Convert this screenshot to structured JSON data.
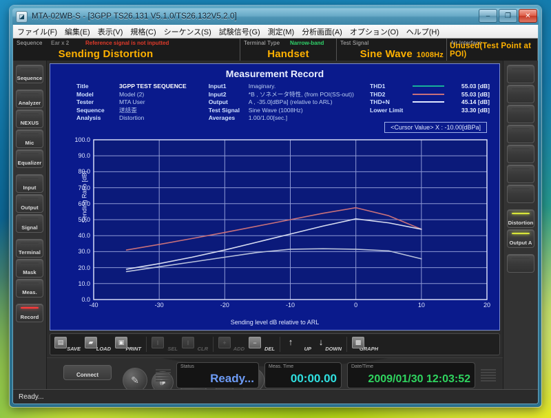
{
  "window": {
    "title": "MTA-02WB-S - [3GPP TS26.131 V5.1.0/TS26.132V5.2.0]",
    "icon": "app-icon",
    "minimize": "–",
    "maximize": "❐",
    "close": "✕"
  },
  "menubar": {
    "items": [
      "ファイル(F)",
      "編集(E)",
      "表示(V)",
      "規格(C)",
      "シーケンス(S)",
      "試験信号(G)",
      "測定(M)",
      "分析画面(A)",
      "オプション(O)",
      "ヘルプ(H)"
    ]
  },
  "infostrip": {
    "sequence_label": "Sequence",
    "ear_label": "Ear x 2",
    "warning": "Reference signal is not inputted",
    "sequence_value": "Sending Distortion",
    "terminal_label": "Terminal Type",
    "terminal_band": "Narrow-band",
    "terminal_value": "Handset",
    "testsignal_label": "Test Signal",
    "testsignal_value": "Sine Wave",
    "testsignal_freq": "1008Hz",
    "airinterface_label": "Air Interface",
    "airinterface_value": "Unused(Test Point at POI)"
  },
  "left_sidebar": {
    "items": [
      {
        "label": "Sequence",
        "state": "normal"
      },
      {
        "label": "Analyzer",
        "state": "normal"
      },
      {
        "label": "NEXUS",
        "state": "normal"
      },
      {
        "label": "Mic",
        "state": "normal"
      },
      {
        "label": "Equalizer",
        "state": "normal"
      },
      {
        "label": "Input",
        "state": "normal"
      },
      {
        "label": "Output",
        "state": "normal"
      },
      {
        "label": "Signal",
        "state": "normal"
      },
      {
        "label": "Terminal",
        "state": "normal"
      },
      {
        "label": "Mask",
        "state": "normal"
      },
      {
        "label": "Meas.",
        "state": "normal"
      },
      {
        "label": "Record",
        "state": "active-red"
      }
    ]
  },
  "right_sidebar": {
    "items": [
      {
        "label": "",
        "state": "empty"
      },
      {
        "label": "",
        "state": "empty"
      },
      {
        "label": "",
        "state": "empty"
      },
      {
        "label": "",
        "state": "empty"
      },
      {
        "label": "",
        "state": "empty"
      },
      {
        "label": "",
        "state": "empty"
      },
      {
        "label": "",
        "state": "empty"
      },
      {
        "label": "Distortion",
        "state": "active-yellow"
      },
      {
        "label": "Output A",
        "state": "active-yellow"
      },
      {
        "label": "",
        "state": "empty"
      }
    ]
  },
  "record": {
    "title": "Measurement Record",
    "meta_left": [
      {
        "key": "Title",
        "value": "3GPP TEST SEQUENCE",
        "emphasis": true
      },
      {
        "key": "Model",
        "value": "Model (2)",
        "emphasis": false
      },
      {
        "key": "Tester",
        "value": "MTA User",
        "emphasis": false
      },
      {
        "key": "Sequence",
        "value": "送話歪",
        "emphasis": false
      },
      {
        "key": "Analysis",
        "value": "Distortion",
        "emphasis": false
      }
    ],
    "meta_right": [
      {
        "key": "Input1",
        "value": "Imaginary."
      },
      {
        "key": "Input2",
        "value": "*B , ソネメータ特性, (from POI(SS-out))"
      },
      {
        "key": "Output",
        "value": "A , -35.0[dBPa] (relative to ARL)"
      },
      {
        "key": "Test Signal",
        "value": "Sine Wave (1008Hz)"
      },
      {
        "key": "Averages",
        "value": "1.00/1.00[sec.]"
      }
    ],
    "legend": [
      {
        "name": "THD1",
        "value": "55.03 [dB]",
        "color": "#17b09a",
        "line": true
      },
      {
        "name": "THD2",
        "value": "55.03 [dB]",
        "color": "#c8707a",
        "line": true
      },
      {
        "name": "THD+N",
        "value": "45.14 [dB]",
        "color": "#dfe6ff",
        "line": true
      },
      {
        "name": "Lower Limit",
        "value": "33.30 [dB]",
        "color": "#cfe0ff",
        "line": false
      }
    ],
    "cursor_value": "<Cursor Value> X : -10.00[dBPa]"
  },
  "chart_data": {
    "type": "line",
    "title": "Measurement Record",
    "xlabel": "Sending level dB relative to ARL",
    "ylabel": "Sending Ratio [dB]",
    "xlim": [
      -40,
      20
    ],
    "ylim": [
      0,
      100
    ],
    "xticks": [
      -40,
      -30,
      -20,
      -10,
      0,
      10,
      20
    ],
    "yticks": [
      0.0,
      10.0,
      20.0,
      30.0,
      40.0,
      50.0,
      60.0,
      70.0,
      80.0,
      90.0,
      100.0
    ],
    "ytick_labels": [
      "0.0",
      "10.0",
      "20.0",
      "30.0",
      "40.0",
      "50.0",
      "60.0",
      "70.0",
      "80.0",
      "90.0",
      "100.0"
    ],
    "xtick_labels": [
      "-40",
      "-30",
      "-20",
      "-10",
      "0",
      "10",
      "20"
    ],
    "grid": true,
    "legend_position": "top-right",
    "series": [
      {
        "name": "THD2",
        "color": "#c8707a",
        "x": [
          -35,
          -30,
          -25,
          -20,
          -15,
          -10,
          -5,
          0,
          5,
          10
        ],
        "y": [
          31.0,
          34.5,
          38.2,
          42.0,
          46.0,
          50.0,
          54.0,
          57.5,
          52.5,
          44.0
        ]
      },
      {
        "name": "THD1",
        "color": "#d7dcf0",
        "x": [
          -35,
          -30,
          -25,
          -20,
          -15,
          -10,
          -5,
          0,
          5,
          10
        ],
        "y": [
          19.0,
          22.5,
          26.5,
          31.0,
          36.0,
          41.0,
          46.0,
          50.5,
          48.0,
          44.0
        ]
      },
      {
        "name": "THD+N",
        "color": "#b9c2dc",
        "x": [
          -35,
          -30,
          -25,
          -20,
          -15,
          -10,
          -5,
          0,
          5,
          10
        ],
        "y": [
          17.5,
          20.5,
          23.5,
          26.5,
          29.5,
          31.5,
          31.8,
          31.5,
          30.5,
          25.5
        ]
      }
    ]
  },
  "record_toolbar": {
    "buttons": [
      {
        "label": "SAVE",
        "icon": "floppy-icon",
        "enabled": true
      },
      {
        "label": "LOAD",
        "icon": "folder-icon",
        "enabled": true
      },
      {
        "label": "PRINT",
        "icon": "printer-icon",
        "enabled": true
      },
      {
        "label": "SEL",
        "icon": "select-icon",
        "enabled": false
      },
      {
        "label": "CLR",
        "icon": "clear-icon",
        "enabled": false
      },
      {
        "label": "ADD",
        "icon": "plus-icon",
        "enabled": false
      },
      {
        "label": "DEL",
        "icon": "minus-icon",
        "enabled": true
      },
      {
        "label": "UP",
        "icon": "arrow-up-icon",
        "enabled": true
      },
      {
        "label": "DOWN",
        "icon": "arrow-down-icon",
        "enabled": true
      },
      {
        "label": "GRAPH",
        "icon": "graph-icon",
        "enabled": true
      }
    ]
  },
  "deck": {
    "connect_label": "Connect",
    "transport": [
      {
        "name": "mic-button",
        "glyph": "✎"
      },
      {
        "name": "speaker-button",
        "glyph": "🕪"
      },
      {
        "name": "play-button",
        "glyph": "▶"
      },
      {
        "name": "stop-button",
        "glyph": "■"
      },
      {
        "name": "record-button",
        "glyph": "●"
      }
    ],
    "status_label": "Status",
    "status_value": "Ready...",
    "meastime_label": "Meas. Time",
    "meastime_value": "00:00.00",
    "datetime_label": "Date/Time",
    "datetime_value": "2009/01/30 12:03:52"
  },
  "statusbar": {
    "text": "Ready..."
  }
}
